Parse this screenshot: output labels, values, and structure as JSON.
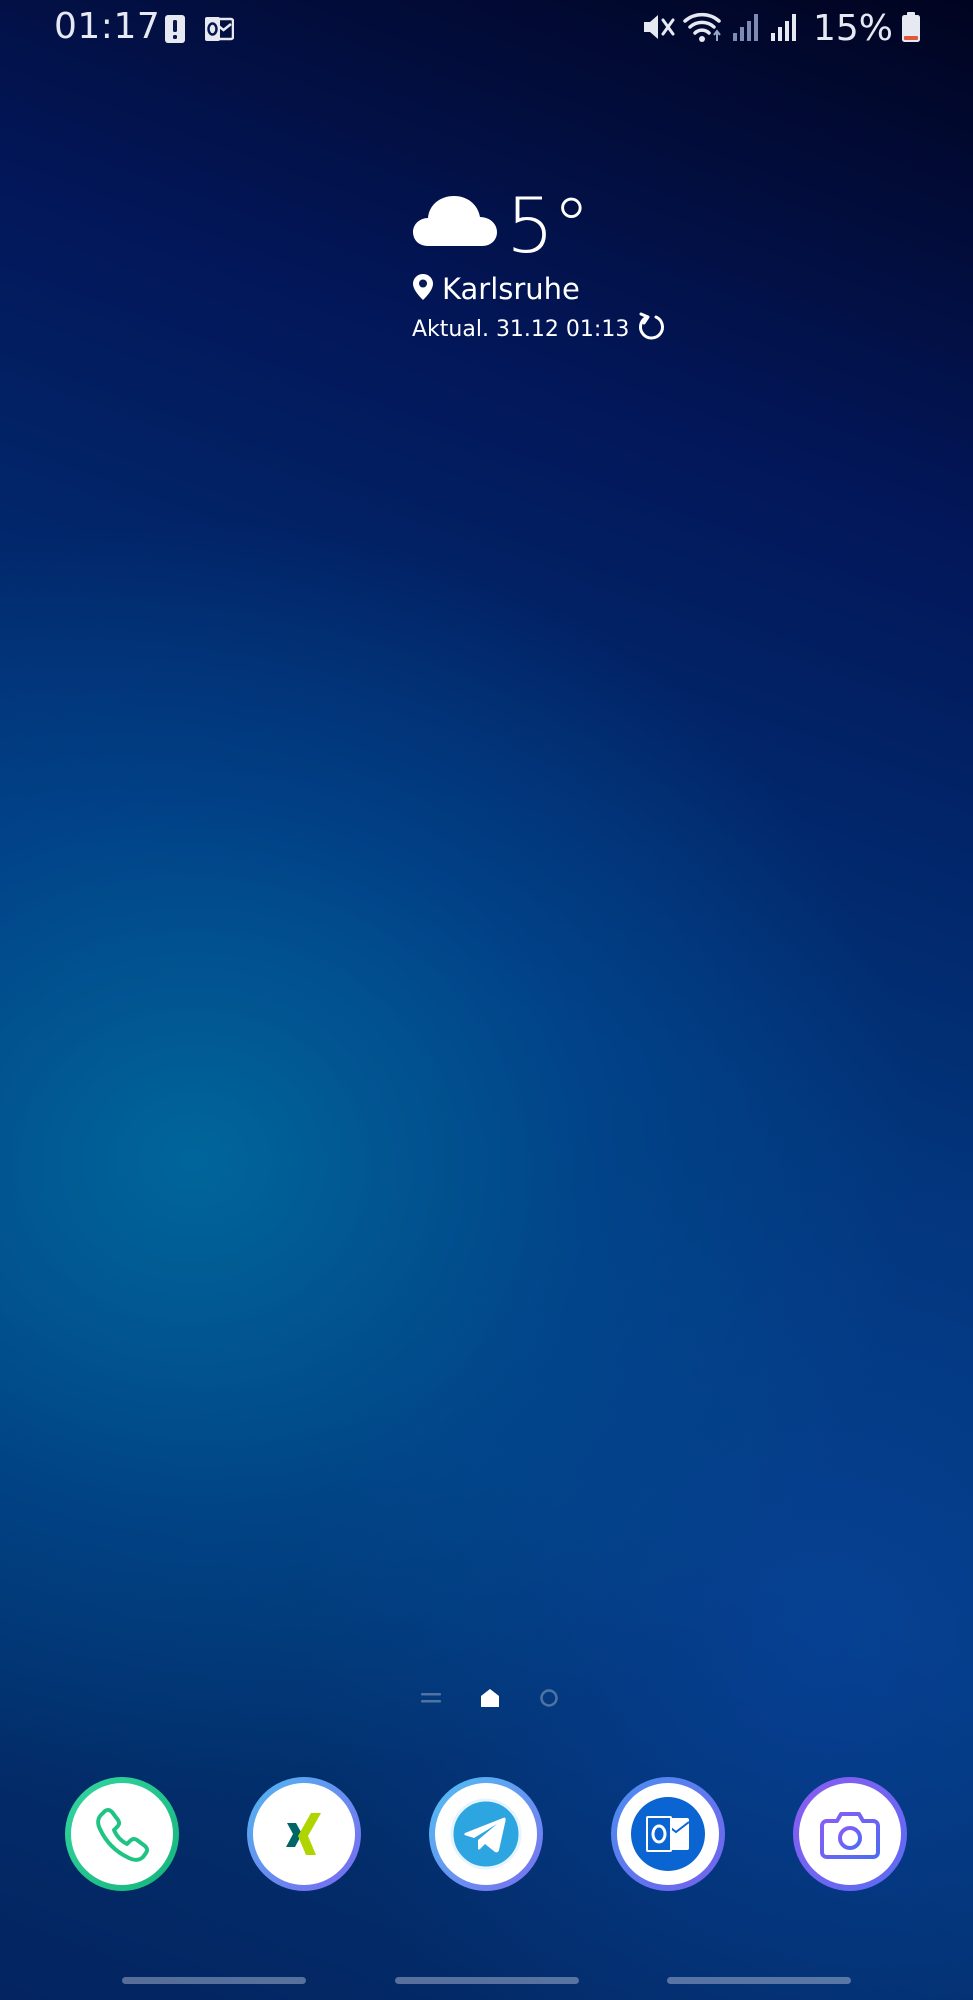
{
  "status_bar": {
    "time": "01:17",
    "battery_percent": "15%",
    "icons": [
      "alert-icon",
      "outlook-notification-icon",
      "mute-icon",
      "wifi-icon",
      "signal-icon",
      "signal-icon",
      "battery-icon"
    ]
  },
  "weather": {
    "temperature": "5°",
    "location": "Karlsruhe",
    "updated": "Aktual. 31.12 01:13",
    "icons": [
      "cloud-icon",
      "location-pin-icon",
      "refresh-icon"
    ]
  },
  "page_indicator": {
    "icons": [
      "menu-page-icon",
      "home-page-icon",
      "page-dot-icon"
    ],
    "active_index": 1
  },
  "dock": {
    "apps": [
      "phone-app-icon",
      "xing-app-icon",
      "telegram-app-icon",
      "outlook-app-icon",
      "camera-app-icon"
    ]
  },
  "colors": {
    "phone_accent": "#1fc483",
    "xing_green": "#b0d400",
    "xing_teal": "#006567",
    "telegram_blue": "#2ca5e0",
    "outlook_blue": "#0a64d1",
    "camera_purple": "#6a5cf0",
    "battery_low": "#e0573a"
  }
}
